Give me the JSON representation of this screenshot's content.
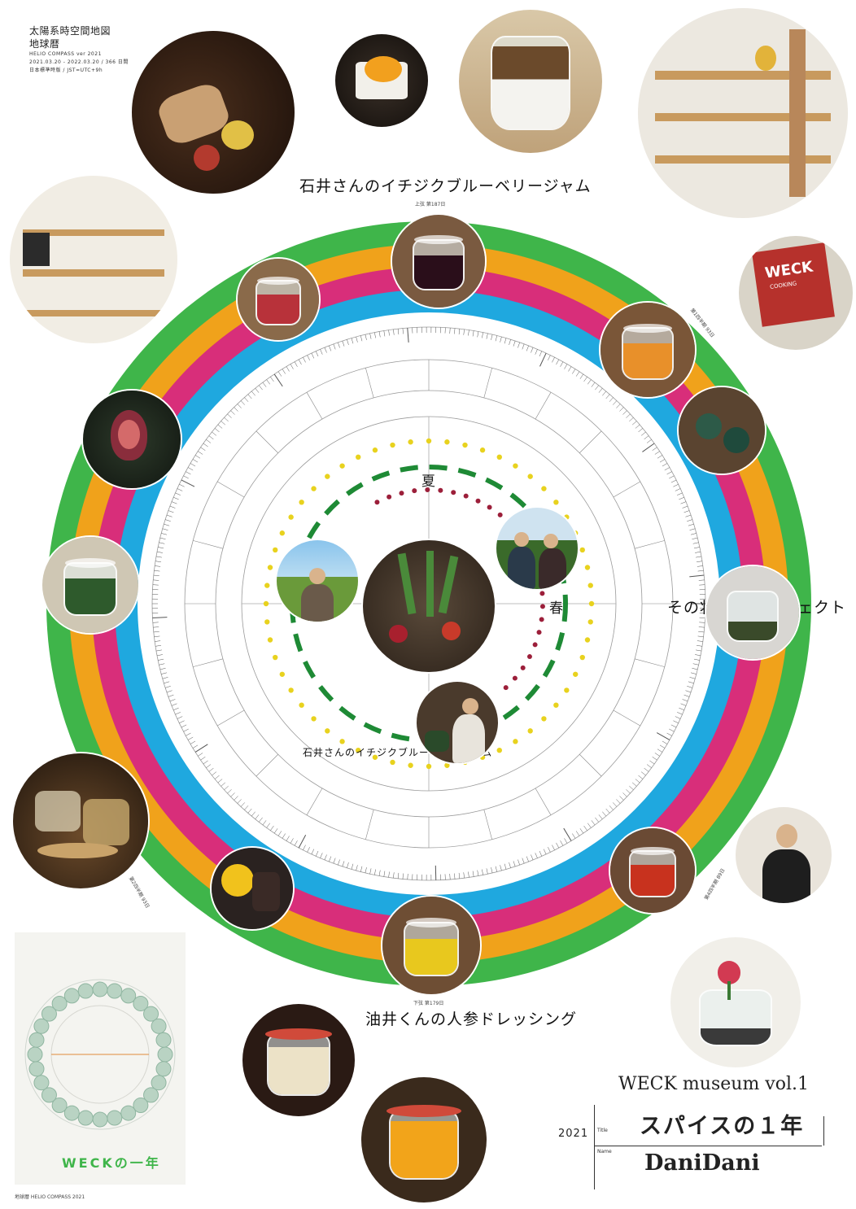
{
  "header": {
    "line1": "太陽系時空間地図",
    "line2": "地球暦",
    "line3": "HELIO COMPASS ver 2021",
    "line4": "2021.03.20 - 2022.03.20 / 366 日間",
    "line5": "日本標準時版 / JST=UTC+9h"
  },
  "captions": {
    "top": "石井さんのイチジクブルーベリージャム",
    "top_small": "上弦 第187日",
    "right": "その壮大なプロジェクト",
    "inner": "石井さんのイチジクブルーベリージャム",
    "bottom": "油井くんの人参ドレッシング",
    "bottom_small": "下弦 第179日",
    "right_small_1": "第1四半期 93日",
    "right_small_2": "第4四半期 89日",
    "left_small": "第2四半期 93日"
  },
  "compass": {
    "summer": "夏",
    "spring": "春",
    "ring_colors": [
      "#3fb54a",
      "#f0a21b",
      "#d82e7a",
      "#1fa8df"
    ],
    "dash_color": "#1e8a35",
    "dot_yellow": "#e8d21e",
    "dot_red": "#9c1f3a"
  },
  "thumbnail": {
    "label": "WECKの一年",
    "footer": "地球暦 HELIO COMPASS 2021"
  },
  "title_block": {
    "series": "WECK museum vol.1",
    "year": "2021",
    "title_label": "Title",
    "name_label": "Name",
    "title": "スパイスの１年",
    "name": "DaniDani"
  },
  "book": {
    "cover_text": "WECK",
    "sub_text": "COOKING"
  }
}
